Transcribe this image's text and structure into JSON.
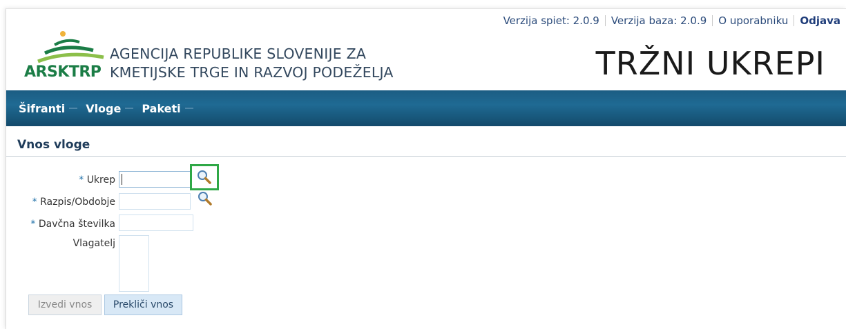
{
  "header": {
    "links": [
      "Verzija spiet: 2.0.9",
      "Verzija baza: 2.0.9",
      "O uporabniku",
      "Odjava"
    ],
    "logo_text": "ARSKTRP",
    "agency_line1": "AGENCIJA REPUBLIKE SLOVENIJE ZA",
    "agency_line2": "KMETIJSKE TRGE IN RAZVOJ PODEŽELJA",
    "app_title": "TRŽNI UKREPI"
  },
  "nav": {
    "items": [
      "Šifranti",
      "Vloge",
      "Paketi"
    ]
  },
  "section": {
    "title": "Vnos vloge"
  },
  "form": {
    "required_mark": "*",
    "ukrep_label": "Ukrep",
    "ukrep_value": "",
    "razpis_label": "Razpis/Obdobje",
    "razpis_value": "",
    "davcna_label": "Davčna številka",
    "davcna_value": "",
    "vlagatelj_label": "Vlagatelj",
    "vlagatelj_value": ""
  },
  "buttons": {
    "submit": "Izvedi vnos",
    "cancel": "Prekliči vnos"
  },
  "icons": {
    "search": "search-icon"
  },
  "colors": {
    "nav": "#1c5d83",
    "highlight": "#2fa846",
    "logo_green": "#1b7d46"
  }
}
